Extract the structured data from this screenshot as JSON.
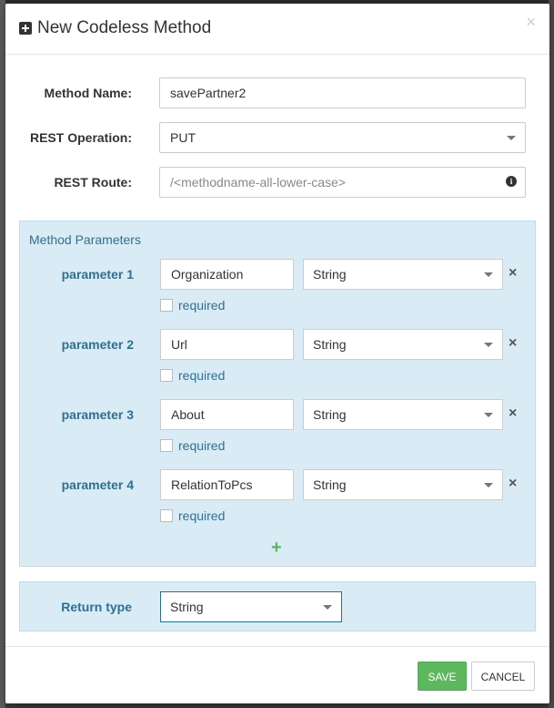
{
  "modal": {
    "title": "New Codeless Method",
    "title_icon": "plus-square-icon",
    "close_label": "×"
  },
  "form": {
    "method_name": {
      "label": "Method Name:",
      "value": "savePartner2"
    },
    "rest_operation": {
      "label": "REST Operation:",
      "value": "PUT"
    },
    "rest_route": {
      "label": "REST Route:",
      "value": "",
      "placeholder": "/<methodname-all-lower-case>",
      "icon": "info-circle-icon"
    }
  },
  "parameters": {
    "title": "Method Parameters",
    "required_label": "required",
    "remove_label": "×",
    "add_label": "+",
    "items": [
      {
        "label": "parameter 1",
        "name": "Organization",
        "type": "String",
        "required": false
      },
      {
        "label": "parameter 2",
        "name": "Url",
        "type": "String",
        "required": false
      },
      {
        "label": "parameter 3",
        "name": "About",
        "type": "String",
        "required": false
      },
      {
        "label": "parameter 4",
        "name": "RelationToPcs",
        "type": "String",
        "required": false
      }
    ]
  },
  "return_type": {
    "label": "Return type",
    "value": "String"
  },
  "footer": {
    "save_label": "SAVE",
    "cancel_label": "CANCEL"
  },
  "colors": {
    "accent": "#2e6f94",
    "panel_bg": "#d9ecf5",
    "save_bg": "#5cb85c",
    "add": "#5cb85c"
  }
}
